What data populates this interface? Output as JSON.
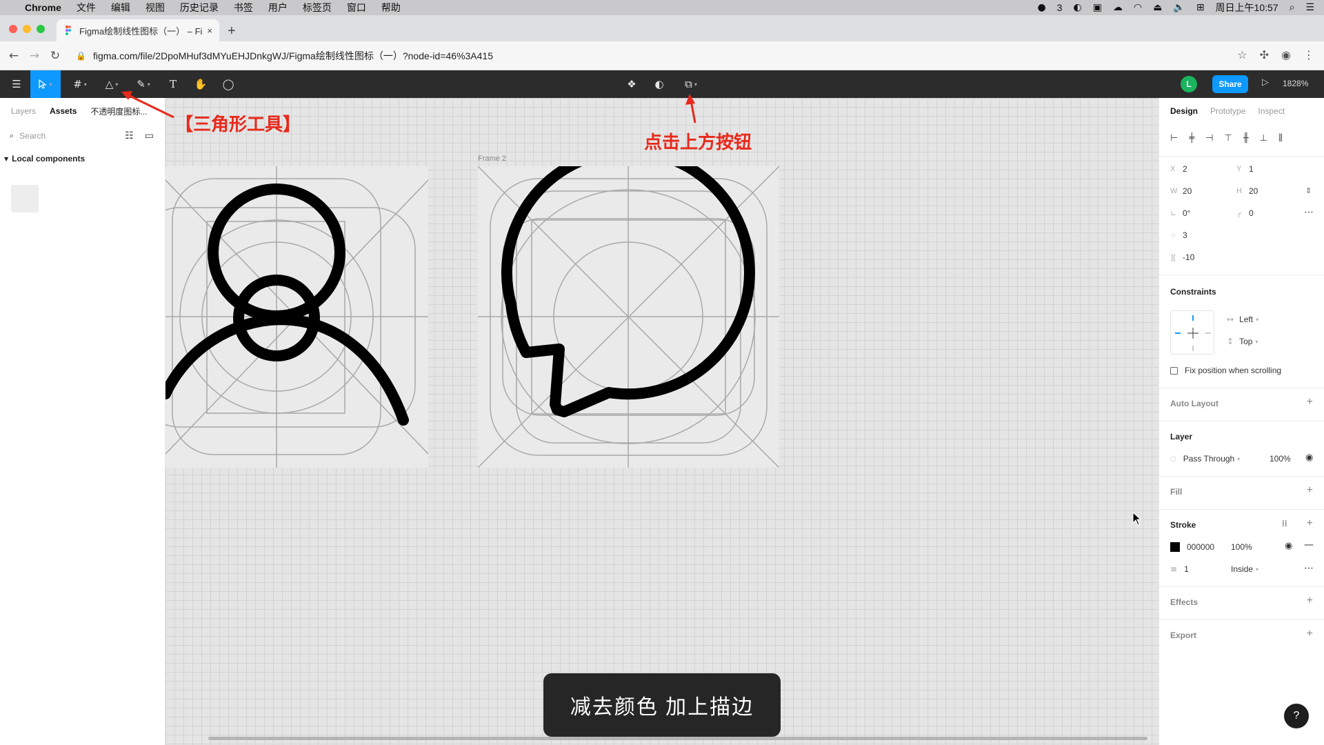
{
  "menubar": {
    "apple": "",
    "app_name": "Chrome",
    "items": [
      "文件",
      "编辑",
      "视图",
      "历史记录",
      "书签",
      "用户",
      "标签页",
      "窗口",
      "帮助"
    ],
    "wechat_count": "3",
    "clock": "周日上午10:57"
  },
  "browser": {
    "tab_title": "Figma绘制线性图标（一） – Fig",
    "tab_close": "×",
    "new_tab": "+",
    "url": "figma.com/file/2DpoMHuf3dMYuEHJDnkgWJ/Figma绘制线性图标（一）?node-id=46%3A415"
  },
  "figma_toolbar": {
    "avatar_initial": "L",
    "share_label": "Share",
    "zoom_label": "1828%"
  },
  "left_panel": {
    "tabs": [
      "Layers",
      "Assets",
      "不透明度图标..."
    ],
    "search_placeholder": "Search",
    "local_components_label": "Local components"
  },
  "canvas": {
    "frame_label": "Frame 2"
  },
  "annotations": {
    "triangle_tool": "【三角形工具】",
    "click_button": "点击上方按钮",
    "caption": "减去颜色  加上描边"
  },
  "right_panel": {
    "tabs": [
      "Design",
      "Prototype",
      "Inspect"
    ],
    "x_label": "X",
    "x_value": "2",
    "y_label": "Y",
    "y_value": "1",
    "w_label": "W",
    "w_value": "20",
    "h_label": "H",
    "h_value": "20",
    "rotation_value": "0°",
    "radius_value": "0",
    "points_value": "3",
    "ratio_value": "-10",
    "constraints_title": "Constraints",
    "constraint_h": "Left",
    "constraint_v": "Top",
    "fix_position_label": "Fix position when scrolling",
    "auto_layout_title": "Auto Layout",
    "layer_title": "Layer",
    "blend_mode": "Pass Through",
    "layer_opacity": "100%",
    "fill_title": "Fill",
    "stroke_title": "Stroke",
    "stroke_color": "000000",
    "stroke_opacity": "100%",
    "stroke_weight": "1",
    "stroke_align": "Inside",
    "effects_title": "Effects",
    "export_title": "Export",
    "help": "?"
  },
  "colors": {
    "accent": "#0d99ff",
    "annotation": "#e8291b",
    "figma_toolbar": "#2c2c2c"
  }
}
